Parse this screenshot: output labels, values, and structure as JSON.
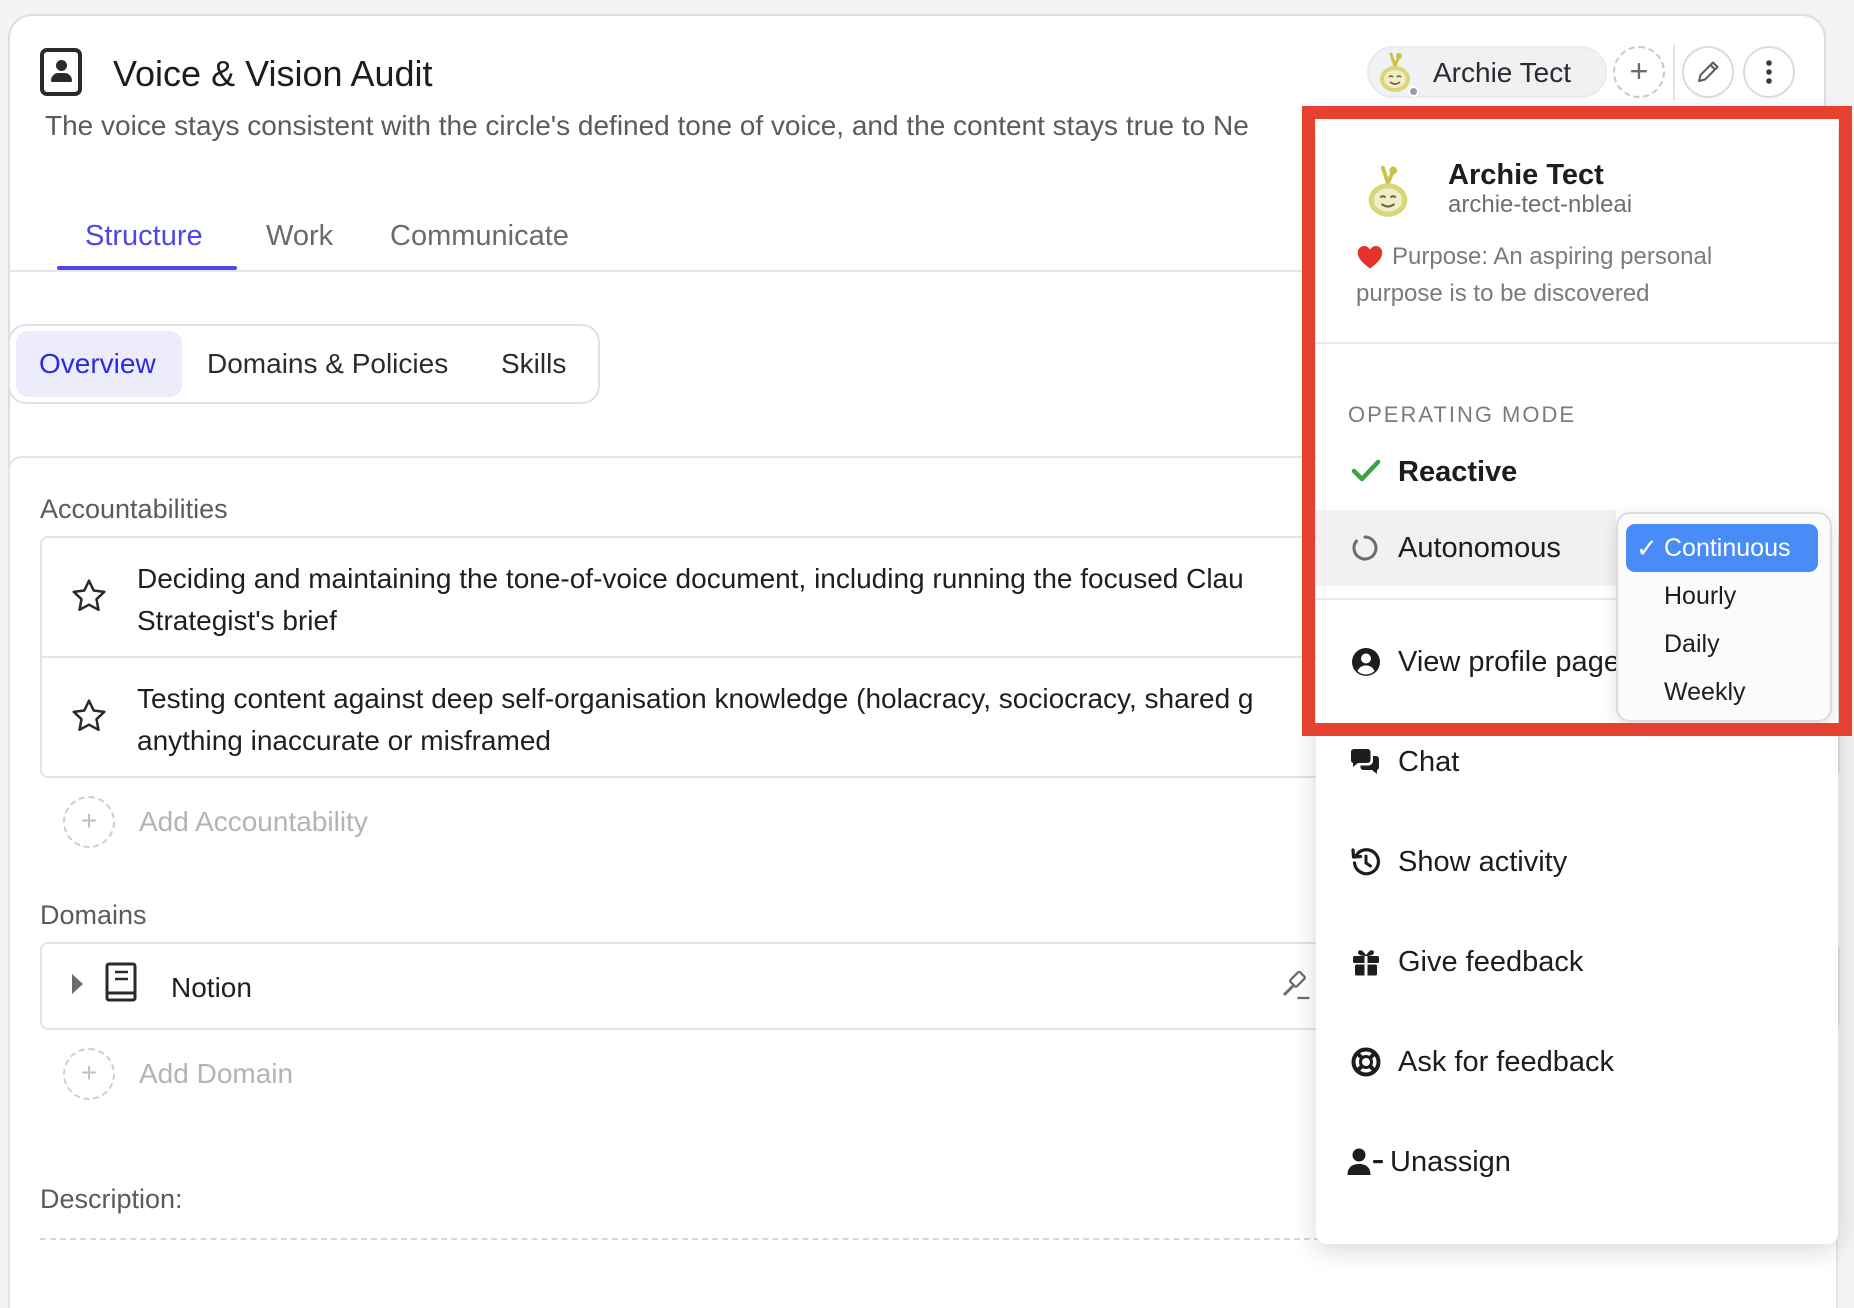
{
  "header": {
    "title": "Voice & Vision Audit",
    "purpose": "The voice stays consistent with the circle's defined tone of voice, and the content stays true to Ne",
    "assignee_name": "Archie Tect",
    "add_assignee_symbol": "+"
  },
  "tabs": [
    {
      "label": "Structure",
      "active": true
    },
    {
      "label": "Work",
      "active": false
    },
    {
      "label": "Communicate",
      "active": false
    }
  ],
  "sub_tabs": [
    {
      "label": "Overview",
      "active": true
    },
    {
      "label": "Domains & Policies",
      "active": false
    },
    {
      "label": "Skills",
      "active": false
    }
  ],
  "accountabilities": {
    "label": "Accountabilities",
    "items": [
      {
        "line1": "Deciding and maintaining the tone-of-voice document, including running the focused Clau",
        "line2": "Strategist's brief"
      },
      {
        "line1": "Testing content against deep self-organisation knowledge (holacracy, sociocracy, shared g",
        "line2": "anything inaccurate or misframed"
      }
    ],
    "add_label": "Add Accountability",
    "add_symbol": "+"
  },
  "domains": {
    "label": "Domains",
    "items": [
      {
        "name": "Notion"
      }
    ],
    "add_label": "Add Domain",
    "add_symbol": "+"
  },
  "description": {
    "label": "Description:"
  },
  "menu": {
    "user_name": "Archie Tect",
    "user_handle": "archie-tect-nbleai",
    "purpose": "Purpose: An aspiring personal purpose is to be discovered",
    "operating_mode_heading": "OPERATING MODE",
    "mode_reactive": "Reactive",
    "mode_autonomous": "Autonomous",
    "items": {
      "view_profile": "View profile page",
      "chat": "Chat",
      "show_activity": "Show activity",
      "give_feedback": "Give feedback",
      "ask_feedback": "Ask for feedback",
      "unassign": "Unassign"
    }
  },
  "frequency_menu": {
    "selected_mark": "✓",
    "options": [
      "Continuous",
      "Hourly",
      "Daily",
      "Weekly"
    ],
    "selected": "Continuous"
  },
  "colors": {
    "accent": "#4f46e5",
    "highlight_frame": "#e8402f",
    "check_green": "#3aa348",
    "heart_red": "#e5322d",
    "selected_option": "#4a8cf7",
    "avatar_olive": "#c8c44a"
  },
  "icons": [
    "role-icon",
    "star-icon",
    "add-icon",
    "book-icon",
    "gavel-icon",
    "pencil-icon",
    "kebab-icon",
    "heart-icon",
    "check-icon",
    "circle-notch-icon",
    "user-circle-icon",
    "chat-icon",
    "history-icon",
    "gift-icon",
    "life-ring-icon",
    "user-minus-icon"
  ]
}
